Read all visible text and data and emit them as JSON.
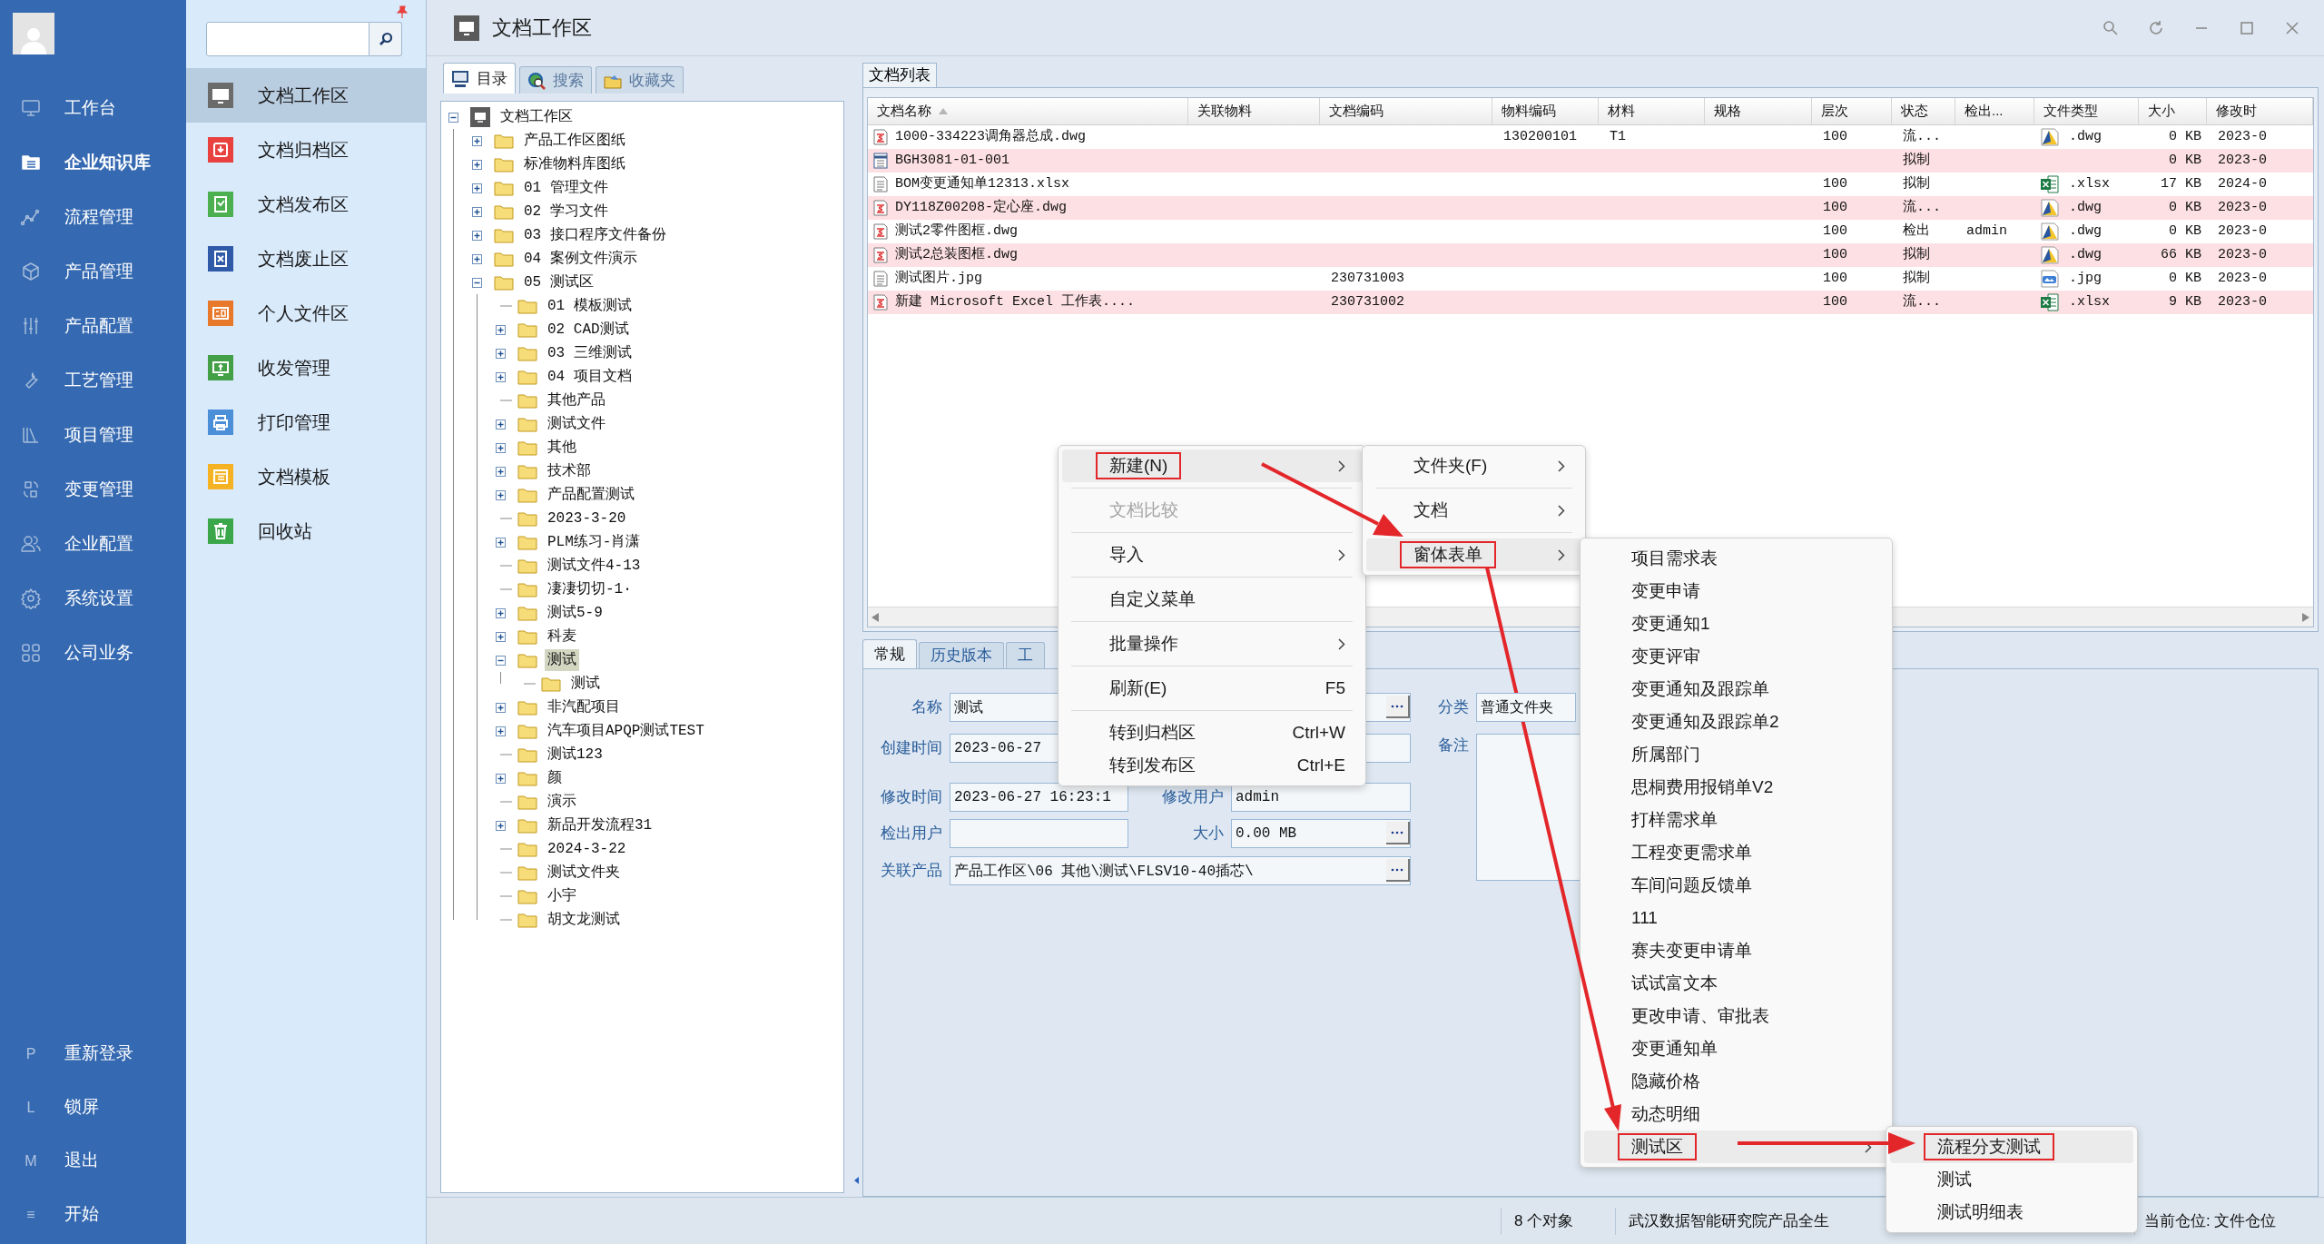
{
  "nav": {
    "items": [
      {
        "label": "工作台",
        "selected": false
      },
      {
        "label": "企业知识库",
        "selected": true
      },
      {
        "label": "流程管理",
        "selected": false
      },
      {
        "label": "产品管理",
        "selected": false
      },
      {
        "label": "产品配置",
        "selected": false
      },
      {
        "label": "工艺管理",
        "selected": false
      },
      {
        "label": "项目管理",
        "selected": false
      },
      {
        "label": "变更管理",
        "selected": false
      },
      {
        "label": "企业配置",
        "selected": false
      },
      {
        "label": "系统设置",
        "selected": false
      },
      {
        "label": "公司业务",
        "selected": false
      }
    ],
    "bottom": [
      {
        "key": "P",
        "label": "重新登录"
      },
      {
        "key": "L",
        "label": "锁屏"
      },
      {
        "key": "M",
        "label": "退出"
      },
      {
        "key": "≡",
        "label": "开始"
      }
    ]
  },
  "modules": [
    {
      "label": "文档工作区",
      "color": "#6b6b6b",
      "selected": true
    },
    {
      "label": "文档归档区",
      "color": "#e8413e",
      "selected": false
    },
    {
      "label": "文档发布区",
      "color": "#4caf50",
      "selected": false
    },
    {
      "label": "文档废止区",
      "color": "#2f5aa8",
      "selected": false
    },
    {
      "label": "个人文件区",
      "color": "#e8792a",
      "selected": false
    },
    {
      "label": "收发管理",
      "color": "#43a047",
      "selected": false
    },
    {
      "label": "打印管理",
      "color": "#4a8fd8",
      "selected": false
    },
    {
      "label": "文档模板",
      "color": "#f5b324",
      "selected": false
    },
    {
      "label": "回收站",
      "color": "#3aa84a",
      "selected": false
    }
  ],
  "window": {
    "title": "文档工作区"
  },
  "left_tabs": [
    {
      "label": "目录",
      "selected": true
    },
    {
      "label": "搜索",
      "selected": false
    },
    {
      "label": "收藏夹",
      "selected": false
    }
  ],
  "tree": {
    "label": "文档工作区",
    "expanded": true,
    "selected": false,
    "children": [
      {
        "label": "产品工作区图纸",
        "expanded": false,
        "selected": false
      },
      {
        "label": "标准物料库图纸",
        "expanded": false,
        "selected": false
      },
      {
        "label": "01 管理文件",
        "expanded": false,
        "selected": false
      },
      {
        "label": "02 学习文件",
        "expanded": false,
        "selected": false
      },
      {
        "label": "03 接口程序文件备份",
        "expanded": false,
        "selected": false
      },
      {
        "label": "04 案例文件演示",
        "expanded": false,
        "selected": false
      },
      {
        "label": "05 测试区",
        "expanded": true,
        "selected": false,
        "children": [
          {
            "label": "01 模板测试",
            "selected": false
          },
          {
            "label": "02 CAD测试",
            "expanded": false,
            "selected": false
          },
          {
            "label": "03 三维测试",
            "expanded": false,
            "selected": false
          },
          {
            "label": "04 项目文档",
            "expanded": false,
            "selected": false
          },
          {
            "label": "其他产品",
            "selected": false
          },
          {
            "label": "测试文件",
            "expanded": false,
            "selected": false
          },
          {
            "label": "其他",
            "expanded": false,
            "selected": false
          },
          {
            "label": "技术部",
            "expanded": false,
            "selected": false
          },
          {
            "label": "产品配置测试",
            "expanded": false,
            "selected": false
          },
          {
            "label": "2023-3-20",
            "selected": false
          },
          {
            "label": "PLM练习-肖潇",
            "expanded": false,
            "selected": false
          },
          {
            "label": "测试文件4-13",
            "selected": false
          },
          {
            "label": "凄凄切切-1·",
            "selected": false
          },
          {
            "label": "测试5-9",
            "expanded": false,
            "selected": false
          },
          {
            "label": "科麦",
            "expanded": false,
            "selected": false
          },
          {
            "label": "测试",
            "expanded": true,
            "selected": true,
            "children": [
              {
                "label": "测试",
                "selected": false
              }
            ]
          },
          {
            "label": "非汽配项目",
            "expanded": false,
            "selected": false
          },
          {
            "label": "汽车项目APQP测试TEST",
            "expanded": false,
            "selected": false
          },
          {
            "label": "测试123",
            "selected": false
          },
          {
            "label": "颜",
            "expanded": false,
            "selected": false
          },
          {
            "label": "演示",
            "selected": false
          },
          {
            "label": "新品开发流程31",
            "expanded": false,
            "selected": false
          },
          {
            "label": "2024-3-22",
            "selected": false
          },
          {
            "label": "测试文件夹",
            "selected": false
          },
          {
            "label": "小宇",
            "selected": false
          },
          {
            "label": "胡文龙测试",
            "selected": false
          }
        ]
      }
    ]
  },
  "list_tab": {
    "label": "文档列表"
  },
  "table": {
    "columns": [
      {
        "label": "文档名称",
        "sorted": true
      },
      {
        "label": "关联物料",
        "sorted": false
      },
      {
        "label": "文档编码",
        "sorted": false
      },
      {
        "label": "物料编码",
        "sorted": false
      },
      {
        "label": "材料",
        "sorted": false
      },
      {
        "label": "规格",
        "sorted": false
      },
      {
        "label": "层次",
        "sorted": false
      },
      {
        "label": "状态",
        "sorted": false
      },
      {
        "label": "检出...",
        "sorted": false
      },
      {
        "label": "文件类型",
        "sorted": false
      },
      {
        "label": "大小",
        "sorted": false
      },
      {
        "label": "修改时",
        "sorted": false
      }
    ],
    "rows": [
      {
        "kind": "stamped",
        "name": "1000-334223调角器总成.dwg",
        "material_code": "130200101",
        "material": "T1",
        "layer": "100",
        "status": "流...",
        "file_type": {
          "kind": "dwg",
          "label": ".dwg"
        },
        "size": "0 KB",
        "modified": "2023-0"
      },
      {
        "kind": "form",
        "name": "BGH3081-01-001",
        "status": "拟制",
        "size": "0 KB",
        "modified": "2023-0"
      },
      {
        "kind": "plain",
        "name": "BOM变更通知单12313.xlsx",
        "layer": "100",
        "status": "拟制",
        "file_type": {
          "kind": "xlsx",
          "label": ".xlsx"
        },
        "size": "17 KB",
        "modified": "2024-0"
      },
      {
        "kind": "stamped",
        "name": "DY118Z00208-定心座.dwg",
        "layer": "100",
        "status": "流...",
        "file_type": {
          "kind": "dwg",
          "label": ".dwg"
        },
        "size": "0 KB",
        "modified": "2023-0"
      },
      {
        "kind": "stamped",
        "name": "测试2零件图框.dwg",
        "layer": "100",
        "status": "检出",
        "checkout": "admin",
        "file_type": {
          "kind": "dwg",
          "label": ".dwg"
        },
        "size": "0 KB",
        "modified": "2023-0"
      },
      {
        "kind": "stamped",
        "name": "测试2总装图框.dwg",
        "layer": "100",
        "status": "拟制",
        "file_type": {
          "kind": "dwg",
          "label": ".dwg"
        },
        "size": "66 KB",
        "modified": "2023-0"
      },
      {
        "kind": "plain",
        "name": "测试图片.jpg",
        "doc_code": "230731003",
        "layer": "100",
        "status": "拟制",
        "file_type": {
          "kind": "jpg",
          "label": ".jpg"
        },
        "size": "0 KB",
        "modified": "2023-0"
      },
      {
        "kind": "stamped",
        "name": "新建 Microsoft Excel 工作表....",
        "doc_code": "230731002",
        "layer": "100",
        "status": "流...",
        "file_type": {
          "kind": "xlsx",
          "label": ".xlsx"
        },
        "size": "9 KB",
        "modified": "2023-0"
      }
    ]
  },
  "detail_tabs": [
    {
      "label": "常规",
      "selected": true
    },
    {
      "label": "历史版本",
      "selected": false
    },
    {
      "label": "工",
      "selected": false
    }
  ],
  "form": {
    "name": {
      "label": "名称",
      "value": "测试"
    },
    "created": {
      "label": "创建时间",
      "value": "2023-06-27"
    },
    "modified": {
      "label": "修改时间",
      "value": "2023-06-27 16:23:1"
    },
    "modified_by": {
      "label": "修改用户",
      "value": "admin"
    },
    "checked_out_by": {
      "label": "检出用户"
    },
    "size": {
      "label": "大小",
      "value": "0.00 MB"
    },
    "product": {
      "label": "关联产品",
      "value": "产品工作区\\06 其他\\测试\\FLSV10-40插芯\\"
    },
    "category": {
      "label": "分类",
      "value": "普通文件夹"
    },
    "remarks": {
      "label": "备注"
    }
  },
  "status_bar": [
    "8 个对象",
    "武汉数据智能研究院产品全生",
    "当前仓位: 文件仓位"
  ],
  "context_menus": [
    {
      "items": [
        {
          "label": "新建(N)",
          "submenu": true,
          "selected": true,
          "disabled": false,
          "separator": true
        },
        {
          "label": "文档比较",
          "submenu": false,
          "selected": false,
          "disabled": true,
          "separator": true
        },
        {
          "label": "导入",
          "submenu": true,
          "selected": false,
          "disabled": false,
          "separator": true
        },
        {
          "label": "自定义菜单",
          "submenu": false,
          "selected": false,
          "disabled": false,
          "separator": true
        },
        {
          "label": "批量操作",
          "submenu": true,
          "selected": false,
          "disabled": false,
          "separator": true
        },
        {
          "label": "刷新(E)",
          "shortcut": "F5",
          "submenu": false,
          "selected": false,
          "disabled": false,
          "separator": true
        },
        {
          "label": "转到归档区",
          "shortcut": "Ctrl+W",
          "submenu": false,
          "selected": false,
          "disabled": false,
          "separator": false
        },
        {
          "label": "转到发布区",
          "shortcut": "Ctrl+E",
          "submenu": false,
          "selected": false,
          "disabled": false,
          "separator": false
        }
      ]
    },
    {
      "items": [
        {
          "label": "文件夹(F)",
          "submenu": true,
          "selected": false,
          "disabled": false,
          "separator": true
        },
        {
          "label": "文档",
          "submenu": true,
          "selected": false,
          "disabled": false,
          "separator": true
        },
        {
          "label": "窗体表单",
          "submenu": true,
          "selected": true,
          "disabled": false,
          "separator": false
        }
      ]
    },
    {
      "items": [
        {
          "label": "项目需求表",
          "submenu": false,
          "selected": false
        },
        {
          "label": "变更申请",
          "submenu": false,
          "selected": false
        },
        {
          "label": "变更通知1",
          "submenu": false,
          "selected": false
        },
        {
          "label": "变更评审",
          "submenu": false,
          "selected": false
        },
        {
          "label": "变更通知及跟踪单",
          "submenu": false,
          "selected": false
        },
        {
          "label": "变更通知及跟踪单2",
          "submenu": false,
          "selected": false
        },
        {
          "label": "所属部门",
          "submenu": false,
          "selected": false
        },
        {
          "label": "思桐费用报销单V2",
          "submenu": false,
          "selected": false
        },
        {
          "label": "打样需求单",
          "submenu": false,
          "selected": false
        },
        {
          "label": "工程变更需求单",
          "submenu": false,
          "selected": false
        },
        {
          "label": "车间问题反馈单",
          "submenu": false,
          "selected": false
        },
        {
          "label": "111",
          "submenu": false,
          "selected": false
        },
        {
          "label": "赛夫变更申请单",
          "submenu": false,
          "selected": false
        },
        {
          "label": "试试富文本",
          "submenu": false,
          "selected": false
        },
        {
          "label": "更改申请、审批表",
          "submenu": false,
          "selected": false
        },
        {
          "label": "变更通知单",
          "submenu": false,
          "selected": false
        },
        {
          "label": "隐藏价格",
          "submenu": false,
          "selected": false
        },
        {
          "label": "动态明细",
          "submenu": false,
          "selected": false
        },
        {
          "label": "测试区",
          "submenu": true,
          "selected": true
        }
      ]
    },
    {
      "items": [
        {
          "label": "流程分支测试",
          "submenu": false,
          "selected": true
        },
        {
          "label": "测试",
          "submenu": false,
          "selected": false
        },
        {
          "label": "测试明细表",
          "submenu": false,
          "selected": false
        }
      ]
    }
  ]
}
